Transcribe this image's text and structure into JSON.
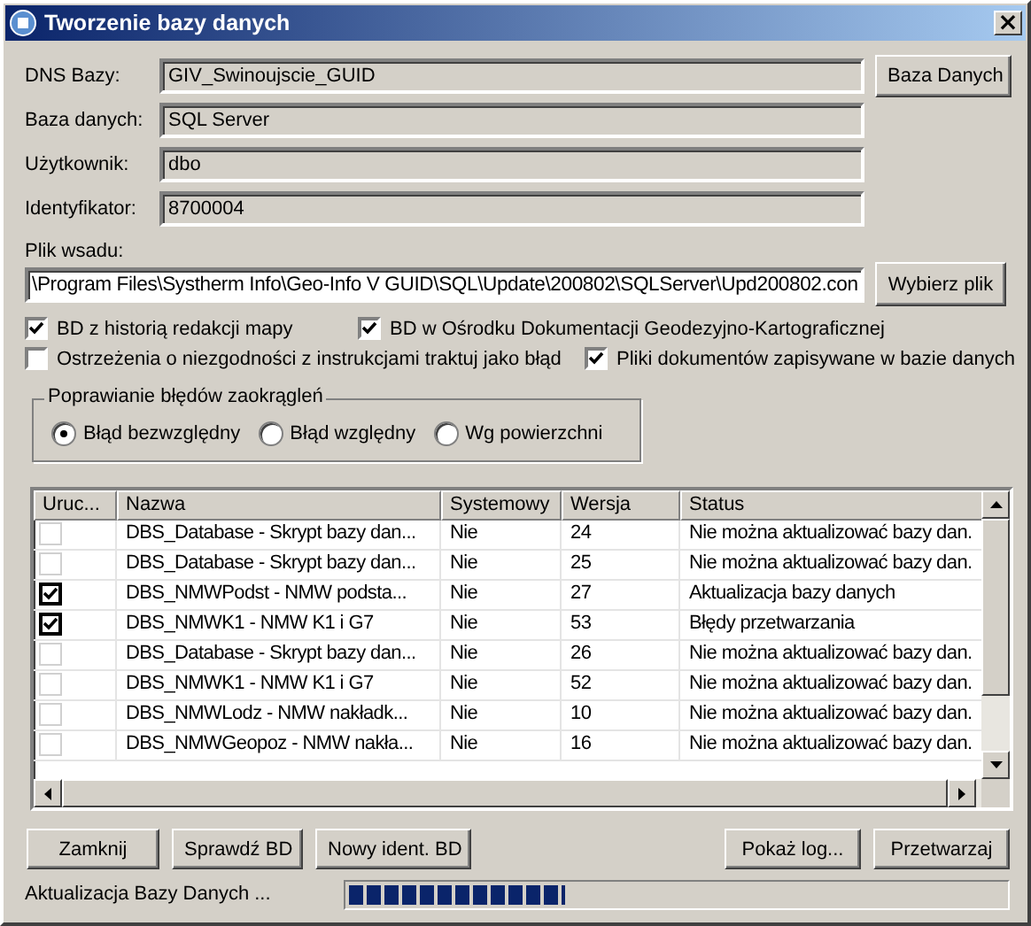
{
  "window": {
    "title": "Tworzenie bazy danych",
    "close": "×"
  },
  "fields": [
    {
      "label": "DNS Bazy:",
      "value": "GIV_Swinoujscie_GUID"
    },
    {
      "label": "Baza danych:",
      "value": "SQL Server"
    },
    {
      "label": "Użytkownik:",
      "value": "dbo"
    },
    {
      "label": "Identyfikator:",
      "value": "8700004"
    }
  ],
  "database_button": "Baza Danych",
  "batch_file": {
    "label": "Plik wsadu:",
    "value": "\\Program Files\\Systherm Info\\Geo-Info V GUID\\SQL\\Update\\200802\\SQLServer\\Upd200802.con"
  },
  "choose_file_button": "Wybierz plik",
  "options": [
    {
      "label": "BD z historią redakcji mapy",
      "checked": true
    },
    {
      "label": "BD w Ośrodku Dokumentacji Geodezyjno-Kartograficznej",
      "checked": true
    },
    {
      "label": "Ostrzeżenia o niezgodności z instrukcjami traktuj jako błąd",
      "checked": false
    },
    {
      "label": "Pliki dokumentów zapisywane w bazie danych",
      "checked": true
    }
  ],
  "rounding": {
    "title": "Poprawianie błędów zaokrągleń",
    "options": [
      {
        "label": "Błąd bezwzględny",
        "selected": true
      },
      {
        "label": "Błąd względny",
        "selected": false
      },
      {
        "label": "Wg powierzchni",
        "selected": false
      }
    ]
  },
  "table": {
    "columns": [
      "Uruc...",
      "Nazwa",
      "Systemowy",
      "Wersja",
      "Status"
    ],
    "rows": [
      {
        "run": false,
        "name": "DBS_Database - Skrypt bazy dan...",
        "system": "Nie",
        "version": "24",
        "status": "Nie można aktualizować bazy dan."
      },
      {
        "run": false,
        "name": "DBS_Database - Skrypt bazy dan...",
        "system": "Nie",
        "version": "25",
        "status": "Nie można aktualizować bazy dan."
      },
      {
        "run": true,
        "name": "DBS_NMWPodst - NMW podsta...",
        "system": "Nie",
        "version": "27",
        "status": "Aktualizacja bazy danych"
      },
      {
        "run": true,
        "name": "DBS_NMWK1 - NMW K1 i G7",
        "system": "Nie",
        "version": "53",
        "status": "Błędy przetwarzania"
      },
      {
        "run": false,
        "name": "DBS_Database - Skrypt bazy dan...",
        "system": "Nie",
        "version": "26",
        "status": "Nie można aktualizować bazy dan."
      },
      {
        "run": false,
        "name": "DBS_NMWK1 - NMW K1 i G7",
        "system": "Nie",
        "version": "52",
        "status": "Nie można aktualizować bazy dan."
      },
      {
        "run": false,
        "name": "DBS_NMWLodz - NMW nakładk...",
        "system": "Nie",
        "version": "10",
        "status": "Nie można aktualizować bazy dan."
      },
      {
        "run": false,
        "name": "DBS_NMWGeopoz - NMW nakła...",
        "system": "Nie",
        "version": "16",
        "status": "Nie można aktualizować bazy dan."
      }
    ]
  },
  "buttons_left": [
    "Zamknij",
    "Sprawdź BD",
    "Nowy ident. BD"
  ],
  "buttons_right": [
    "Pokaż log...",
    "Przetwarzaj"
  ],
  "status_bar": {
    "text": "Aktualizacja Bazy Danych ...",
    "level": 0.33
  }
}
